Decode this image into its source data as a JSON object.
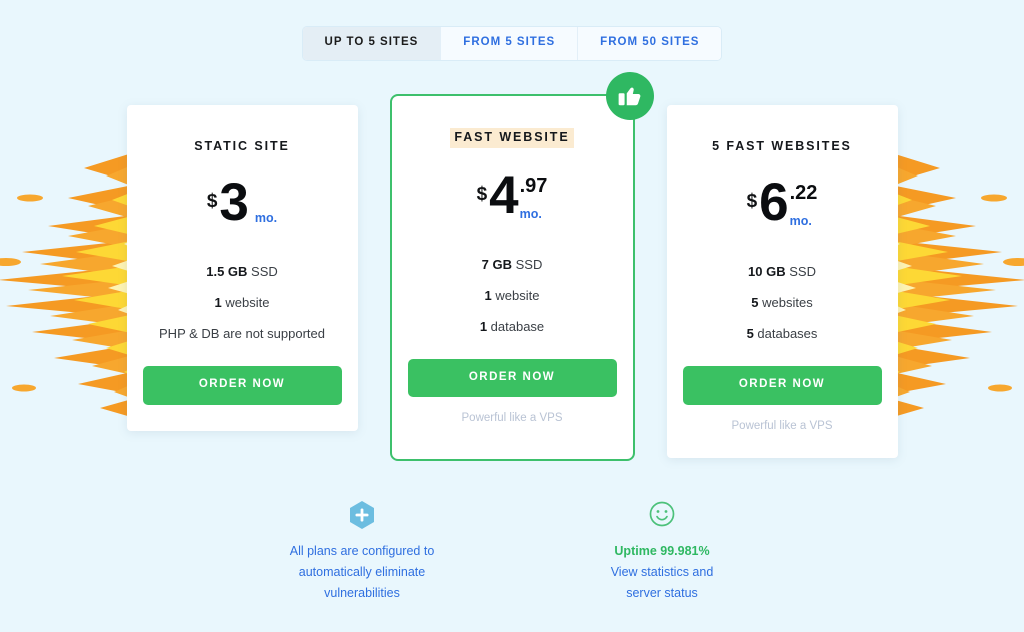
{
  "page": {
    "background_color": "#e9f7fd"
  },
  "tabs": {
    "items": [
      {
        "label": "UP TO 5 SITES",
        "active": true
      },
      {
        "label": "FROM 5 SITES",
        "active": false
      },
      {
        "label": "FROM 50 SITES",
        "active": false
      }
    ]
  },
  "plans": [
    {
      "title": "STATIC SITE",
      "highlight_title": false,
      "currency": "$",
      "amount": "3",
      "cents": "",
      "per": "mo.",
      "features": [
        {
          "strong": "1.5 GB",
          "rest": " SSD"
        },
        {
          "strong": "1",
          "rest": " website"
        },
        {
          "strong": "",
          "rest": "PHP & DB are not supported"
        }
      ],
      "button_label": "ORDER NOW",
      "note": "",
      "featured": false
    },
    {
      "title": "FAST WEBSITE",
      "highlight_title": true,
      "currency": "$",
      "amount": "4",
      "cents": ".97",
      "per": "mo.",
      "features": [
        {
          "strong": "7 GB",
          "rest": " SSD"
        },
        {
          "strong": "1",
          "rest": " website"
        },
        {
          "strong": "1",
          "rest": " database"
        }
      ],
      "button_label": "ORDER NOW",
      "note": "Powerful like a VPS",
      "featured": true,
      "badge_icon": "thumbs-up-icon"
    },
    {
      "title": "5 FAST WEBSITES",
      "highlight_title": false,
      "currency": "$",
      "amount": "6",
      "cents": ".22",
      "per": "mo.",
      "features": [
        {
          "strong": "10 GB",
          "rest": " SSD"
        },
        {
          "strong": "5",
          "rest": " websites"
        },
        {
          "strong": "5",
          "rest": " databases"
        }
      ],
      "button_label": "ORDER NOW",
      "note": "Powerful like a VPS",
      "featured": false
    }
  ],
  "notes": [
    {
      "icon": "hexagon-plus-icon",
      "icon_color": "#6cbde0",
      "line1": "All plans are configured to",
      "line2": "automatically eliminate",
      "line3": "vulnerabilities",
      "uptime": ""
    },
    {
      "icon": "smiley-face-icon",
      "icon_color": "#4cc17a",
      "uptime": "Uptime 99.981%",
      "line1": "View statistics and",
      "line2": "server status",
      "line3": ""
    }
  ],
  "colors": {
    "accent_green": "#3ac162",
    "link_blue": "#2f6fe0",
    "highlight_cream": "#fbebd1",
    "burst_outer": "#f59a23",
    "burst_mid": "#fdd835",
    "burst_inner": "#fdf3b4"
  }
}
